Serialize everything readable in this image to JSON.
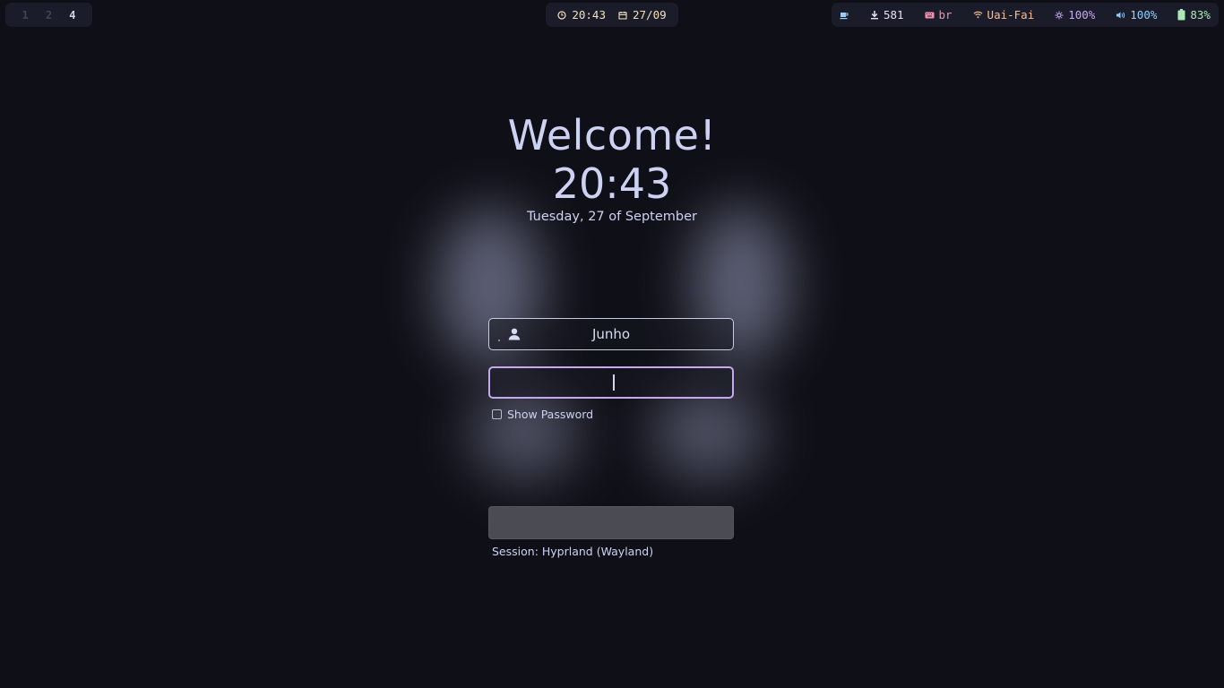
{
  "topbar": {
    "workspaces": [
      {
        "label": "1",
        "active": false
      },
      {
        "label": "2",
        "active": false
      },
      {
        "label": "4",
        "active": true
      }
    ],
    "clock": {
      "time": "20:43",
      "date": "27/09",
      "time_icon": "clock-icon",
      "date_icon": "calendar-icon"
    },
    "status": {
      "coffee_icon": "coffee-icon",
      "updates": {
        "icon": "download-icon",
        "value": "581",
        "color": "#e9e2f7"
      },
      "keyboard": {
        "icon": "keyboard-icon",
        "value": "br",
        "color": "#f28fad"
      },
      "wifi": {
        "icon": "wifi-icon",
        "value": "Uai-Fai",
        "color": "#f8bd96"
      },
      "brightness": {
        "icon": "brightness-icon",
        "value": "100%",
        "color": "#c9a7f5"
      },
      "volume": {
        "icon": "volume-icon",
        "value": "100%",
        "color": "#96cdfb"
      },
      "battery": {
        "icon": "battery-icon",
        "value": "83%",
        "color": "#abe9b3",
        "level": 0.83
      }
    }
  },
  "login": {
    "welcome": "Welcome!",
    "time": "20:43",
    "date": "Tuesday, 27 of September",
    "username": "Junho",
    "password_value": "",
    "show_password_label": "Show Password",
    "show_password_checked": false,
    "login_button_label": "",
    "session": "Session: Hyprland (Wayland)"
  },
  "colors": {
    "background": "#0f1017",
    "accent": "#c7a8ef",
    "text": "#cdd2f3"
  }
}
